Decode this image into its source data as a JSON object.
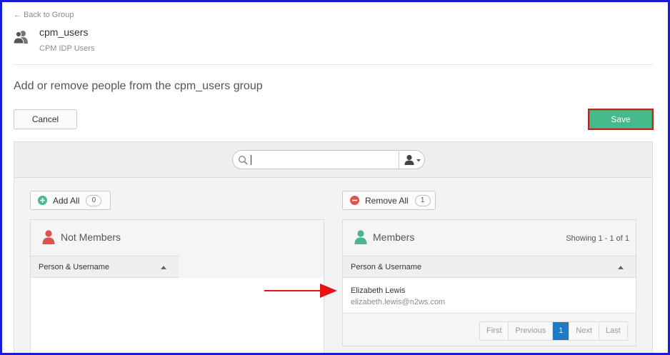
{
  "header": {
    "back_link": "← Back to Group",
    "group_name": "cpm_users",
    "group_desc": "CPM IDP Users",
    "page_title": "Add or remove people from the cpm_users group",
    "group_icon": "group-icon"
  },
  "actions": {
    "cancel_label": "Cancel",
    "save_label": "Save"
  },
  "search": {
    "value": "",
    "placeholder": "",
    "search_icon": "search-icon",
    "filter_icon": "person-filter-icon"
  },
  "not_members": {
    "title": "Not Members",
    "add_all_label": "Add All",
    "add_all_count": "0",
    "column_header": "Person & Username",
    "icon": "person-icon",
    "icon_color": "#e0524f"
  },
  "members": {
    "title": "Members",
    "remove_all_label": "Remove All",
    "remove_all_count": "1",
    "showing": "Showing 1 - 1 of 1",
    "column_header": "Person & Username",
    "icon": "person-icon",
    "icon_color": "#46b98a",
    "rows": [
      {
        "name": "Elizabeth Lewis",
        "email": "elizabeth.lewis@n2ws.com"
      }
    ],
    "pager": {
      "first": "First",
      "previous": "Previous",
      "current": "1",
      "next": "Next",
      "last": "Last"
    }
  },
  "colors": {
    "save": "#46b98a",
    "annotation": "#d41a1a",
    "frame": "#1a1adb",
    "pager_active": "#1f7ac6"
  }
}
